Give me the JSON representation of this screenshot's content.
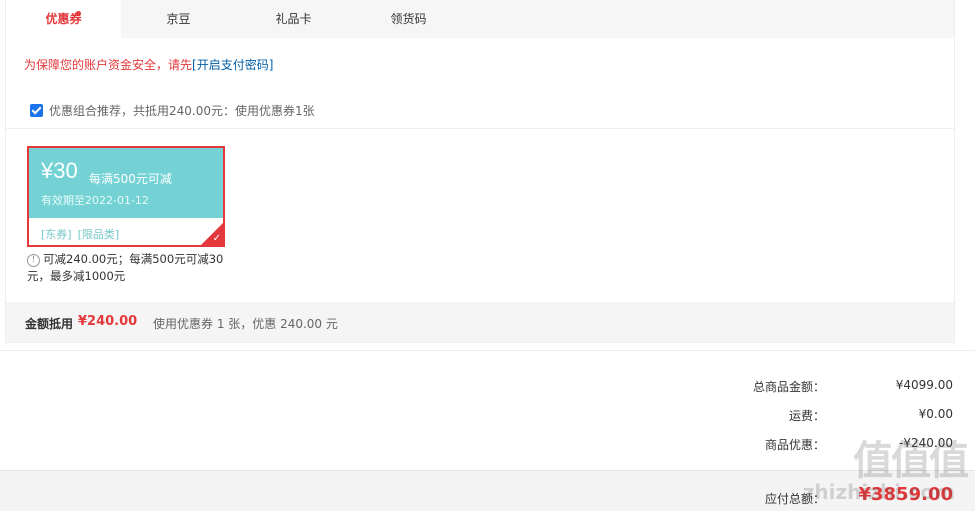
{
  "tabs": [
    {
      "label": "优惠券",
      "active": true
    },
    {
      "label": "京豆"
    },
    {
      "label": "礼品卡"
    },
    {
      "label": "领货码"
    }
  ],
  "security": {
    "text": "为保障您的账户资金安全，请先",
    "link": "[开启支付密码]"
  },
  "combo": {
    "text": "优惠组合推荐，共抵用240.00元：使用优惠券1张",
    "checked": true
  },
  "coupon": {
    "amount": "¥30",
    "condition": "每满500元可减",
    "expiry": "有效期至2022-01-12",
    "tag1": "[东券]",
    "tag2": "[限品类]",
    "note": "可减240.00元；每满500元可减30元，最多减1000元"
  },
  "summary": {
    "label": "金额抵用",
    "value": "¥240.00",
    "desc": "使用优惠券 1 张，优惠 240.00 元"
  },
  "totals": {
    "goods_label": "总商品金额：",
    "goods_value": "¥4099.00",
    "freight_label": "运费：",
    "freight_value": "¥0.00",
    "discount_label": "商品优惠：",
    "discount_value": "-¥240.00",
    "pay_label": "应付总额：",
    "pay_value": "¥3859.00"
  },
  "watermark": {
    "logo": "值值值",
    "url": "zhizhizhi.com"
  },
  "colors": {
    "accent": "#e4393c",
    "coupon": "#74d2d4",
    "link": "#005ea7"
  }
}
